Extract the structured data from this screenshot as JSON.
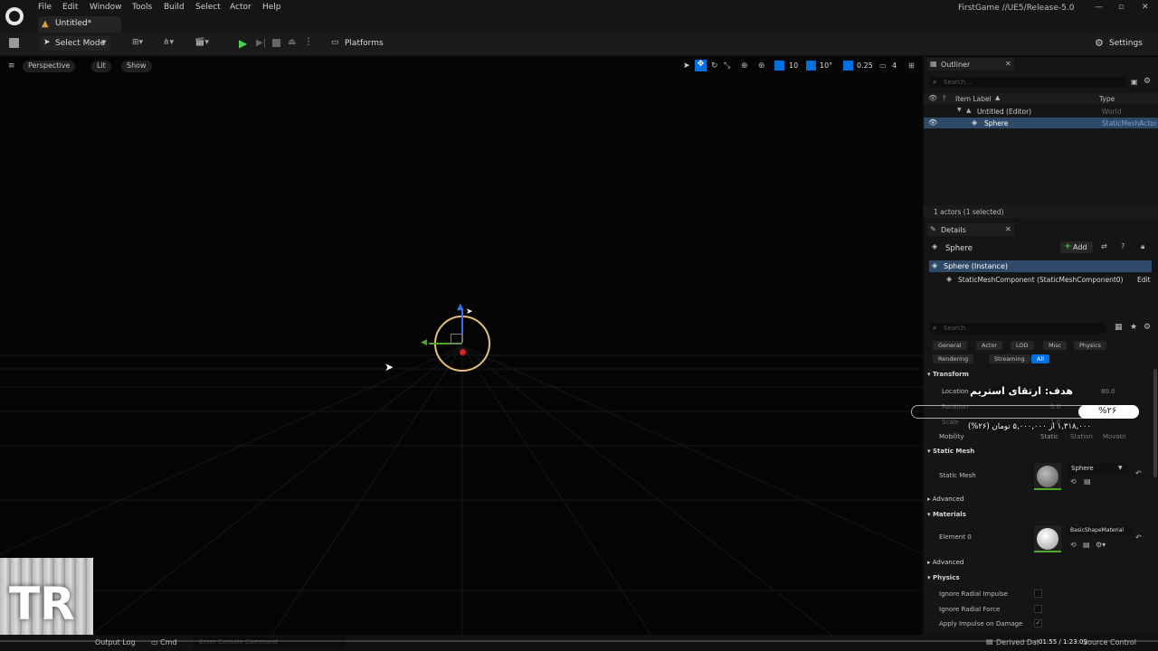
{
  "menu": {
    "file": "File",
    "edit": "Edit",
    "window": "Window",
    "tools": "Tools",
    "build": "Build",
    "select": "Select",
    "actor": "Actor",
    "help": "Help"
  },
  "tab_title": "Untitled*",
  "project_title": "FirstGame //UE5/Release-5.0",
  "toolbar": {
    "select_mode": "Select Mode",
    "platforms": "Platforms",
    "settings": "Settings"
  },
  "viewport": {
    "perspective": "Perspective",
    "lit": "Lit",
    "show": "Show",
    "grid_snap": "10",
    "rotation_snap": "10°",
    "scale_snap": "0.25",
    "camera_speed": "4"
  },
  "outliner": {
    "title": "Outliner",
    "search_placeholder": "Search...",
    "col_label": "Item Label",
    "col_type": "Type",
    "rows": [
      {
        "label": "Untitled (Editor)",
        "type": "World"
      },
      {
        "label": "Sphere",
        "type": "StaticMeshActor"
      }
    ],
    "status": "1 actors (1 selected)"
  },
  "details": {
    "title": "Details",
    "actor_name": "Sphere",
    "add_label": "Add",
    "instance": "Sphere (Instance)",
    "component": "StaticMeshComponent (StaticMeshComponent0)",
    "edit": "Edit",
    "search_placeholder": "Search",
    "filters": [
      "General",
      "Actor",
      "LOD",
      "Misc",
      "Physics",
      "Rendering",
      "Streaming",
      "All"
    ],
    "sections": {
      "transform": "Transform",
      "static_mesh": "Static Mesh",
      "advanced": "Advanced",
      "materials": "Materials",
      "physics": "Physics"
    },
    "location": "Location",
    "location_value": "80.0",
    "rotation": "Rotation",
    "rotation_value": "0.0",
    "scale": "Scale",
    "scale_value": "1.0",
    "mobility": "Mobility",
    "mobility_opts": [
      "Static",
      "Station",
      "Movabl"
    ],
    "static_mesh_label": "Static Mesh",
    "static_mesh_value": "Sphere",
    "element0": "Element 0",
    "material_value": "BasicShapeMaterial",
    "physics_rows": [
      "Ignore Radial Impulse",
      "Ignore Radial Force",
      "Apply Impulse on Damage"
    ]
  },
  "overlay": {
    "goal": "هدف: ارتقای استریم",
    "percent": "%۲۶",
    "progress_text": "۱,۳۱۸,۰۰۰ از ۵,۰۰۰,۰۰۰ تومان (۲۶%)",
    "progress": 0.26
  },
  "statusbar": {
    "output_log": "Output Log",
    "cmd": "Cmd",
    "console_placeholder": "Enter Console Command",
    "derived": "Derived Data",
    "time": "01:55 / 1:23:09",
    "source_control": "Source Control"
  },
  "watermark": "TR",
  "colors": {
    "accent": "#0070e0",
    "selected_row": "#2f4a68",
    "play_green": "#4fcf4f"
  }
}
